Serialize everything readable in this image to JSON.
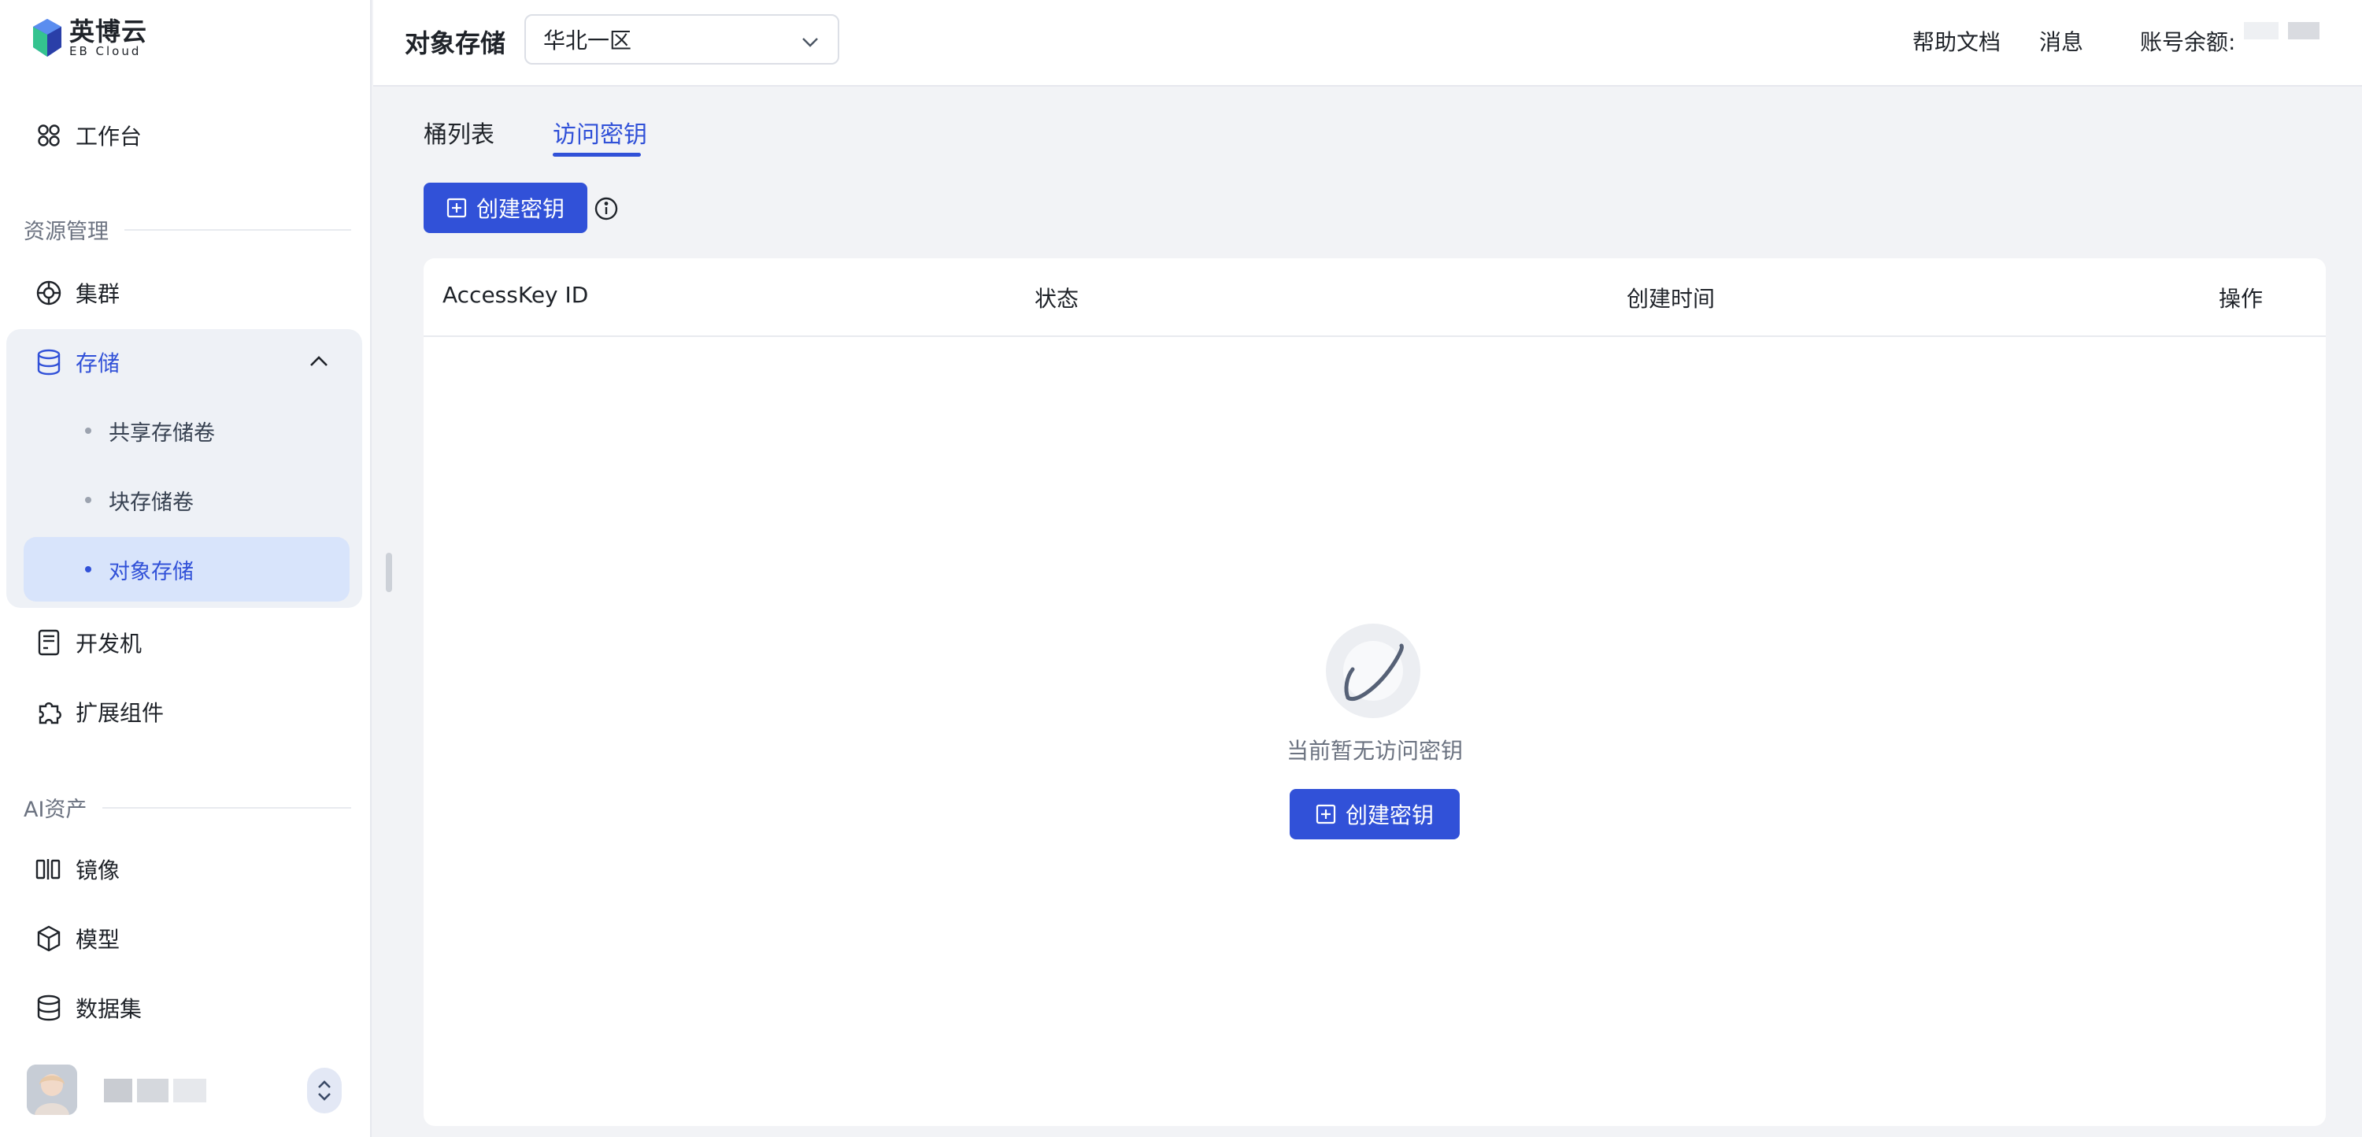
{
  "brand": {
    "name_cn": "英博云",
    "name_en": "EB Cloud"
  },
  "sidebar": {
    "workbench": "工作台",
    "sections": [
      {
        "title": "资源管理"
      },
      {
        "title": "AI资产"
      }
    ],
    "cluster": "集群",
    "storage": {
      "label": "存储",
      "expanded": true,
      "children": [
        {
          "label": "共享存储卷",
          "active": false
        },
        {
          "label": "块存储卷",
          "active": false
        },
        {
          "label": "对象存储",
          "active": true
        }
      ]
    },
    "devmachine": "开发机",
    "extensions": "扩展组件",
    "image": "镜像",
    "model": "模型",
    "dataset": "数据集"
  },
  "header": {
    "title": "对象存储",
    "region": {
      "selected": "华北一区"
    },
    "help": "帮助文档",
    "messages": "消息",
    "balance_label": "账号余额:"
  },
  "tabs": [
    {
      "label": "桶列表",
      "active": false
    },
    {
      "label": "访问密钥",
      "active": true
    }
  ],
  "toolbar": {
    "create_key_label": "创建密钥"
  },
  "table": {
    "columns": [
      "AccessKey ID",
      "状态",
      "创建时间",
      "操作"
    ],
    "rows": []
  },
  "empty_state": {
    "message": "当前暂无访问密钥",
    "button_label": "创建密钥"
  },
  "colors": {
    "accent": "#3151d8",
    "active_bg": "#d8e4fb",
    "page_bg": "#f2f3f6"
  }
}
